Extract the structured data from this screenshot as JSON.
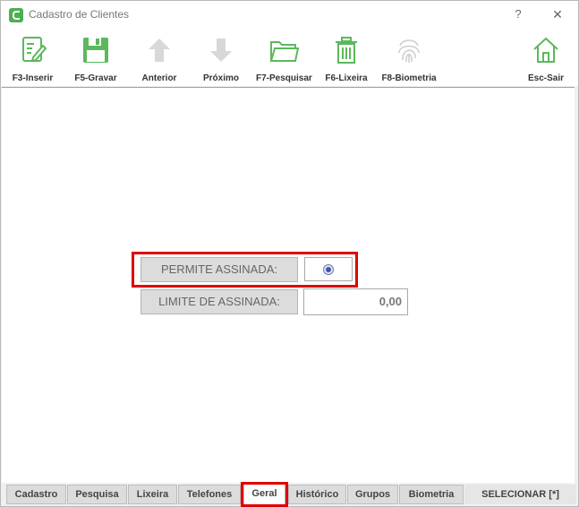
{
  "window": {
    "title": "Cadastro de Clientes",
    "help": "?",
    "close": "✕"
  },
  "toolbar": {
    "insert": "F3-Inserir",
    "save": "F5-Gravar",
    "previous": "Anterior",
    "next": "Próximo",
    "search": "F7-Pesquisar",
    "trash": "F6-Lixeira",
    "biometry": "F8-Biometria",
    "exit": "Esc-Sair"
  },
  "form": {
    "permite_label": "PERMITE ASSINADA:",
    "permite_selected": true,
    "limite_label": "LIMITE DE ASSINADA:",
    "limite_value": "0,00"
  },
  "tabs": [
    "Cadastro",
    "Pesquisa",
    "Lixeira",
    "Telefones",
    "Geral",
    "Histórico",
    "Grupos",
    "Biometria"
  ],
  "active_tab": "Geral",
  "select_label": "SELECIONAR [*]",
  "colors": {
    "accent": "#5cb85c",
    "highlight": "#e00000",
    "disabled": "#c8c8c8"
  }
}
